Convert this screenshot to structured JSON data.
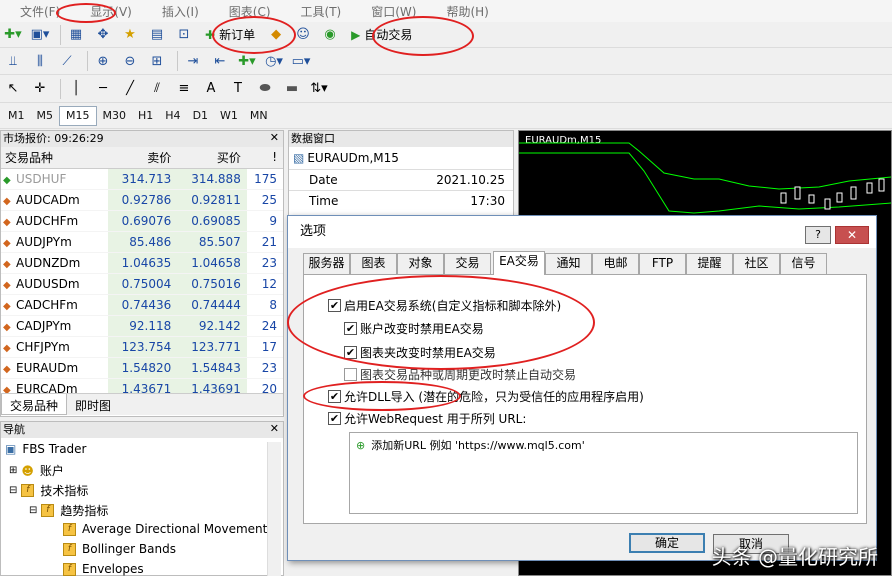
{
  "menu": [
    "文件(F)",
    "显示(V)",
    "插入(I)",
    "图表(C)",
    "工具(T)",
    "窗口(W)",
    "帮助(H)"
  ],
  "toolbar": {
    "new_order": "新订单",
    "auto_trading": "自动交易"
  },
  "draw_tools": [
    "A",
    "T"
  ],
  "timeframes": [
    "M1",
    "M5",
    "M15",
    "M30",
    "H1",
    "H4",
    "D1",
    "W1",
    "MN"
  ],
  "active_timeframe": "M15",
  "market_watch": {
    "title": "市场报价: 09:26:29",
    "headers": [
      "交易品种",
      "卖价",
      "买价",
      "!"
    ],
    "rows": [
      {
        "symbol": "USDHUF",
        "bid": "314.713",
        "ask": "314.888",
        "spread": "175",
        "dim": true
      },
      {
        "symbol": "AUDCADm",
        "bid": "0.92786",
        "ask": "0.92811",
        "spread": "25"
      },
      {
        "symbol": "AUDCHFm",
        "bid": "0.69076",
        "ask": "0.69085",
        "spread": "9"
      },
      {
        "symbol": "AUDJPYm",
        "bid": "85.486",
        "ask": "85.507",
        "spread": "21"
      },
      {
        "symbol": "AUDNZDm",
        "bid": "1.04635",
        "ask": "1.04658",
        "spread": "23"
      },
      {
        "symbol": "AUDUSDm",
        "bid": "0.75004",
        "ask": "0.75016",
        "spread": "12"
      },
      {
        "symbol": "CADCHFm",
        "bid": "0.74436",
        "ask": "0.74444",
        "spread": "8"
      },
      {
        "symbol": "CADJPYm",
        "bid": "92.118",
        "ask": "92.142",
        "spread": "24"
      },
      {
        "symbol": "CHFJPYm",
        "bid": "123.754",
        "ask": "123.771",
        "spread": "17"
      },
      {
        "symbol": "EURAUDm",
        "bid": "1.54820",
        "ask": "1.54843",
        "spread": "23"
      },
      {
        "symbol": "EURCADm",
        "bid": "1.43671",
        "ask": "1.43691",
        "spread": "20"
      }
    ],
    "tabs": [
      "交易品种",
      "即时图"
    ]
  },
  "navigator": {
    "title": "导航",
    "items": [
      "FBS Trader",
      "账户",
      "技术指标",
      "趋势指标",
      "Average Directional Movement",
      "Bollinger Bands",
      "Envelopes"
    ]
  },
  "data_window": {
    "title": "数据窗口",
    "symbol": "EURAUDm,M15",
    "rows": [
      {
        "label": "Date",
        "value": "2021.10.25"
      },
      {
        "label": "Time",
        "value": "17:30"
      }
    ]
  },
  "chart": {
    "label": "EURAUDm,M15"
  },
  "dialog": {
    "title": "选项",
    "tabs": [
      "服务器",
      "图表",
      "对象",
      "交易",
      "EA交易",
      "通知",
      "电邮",
      "FTP",
      "提醒",
      "社区",
      "信号"
    ],
    "active_tab": "EA交易",
    "options": [
      {
        "label": "启用EA交易系统(自定义指标和脚本除外)",
        "checked": true
      },
      {
        "label": "账户改变时禁用EA交易",
        "checked": true
      },
      {
        "label": "图表夹改变时禁用EA交易",
        "checked": true
      },
      {
        "label": "图表交易品种或周期更改时禁止自动交易",
        "checked": false
      },
      {
        "label": "允许DLL导入 (潜在的危险，只为受信任的应用程序启用)",
        "checked": true
      },
      {
        "label": "允许WebRequest 用于所列 URL:",
        "checked": true
      }
    ],
    "add_url_hint": "添加新URL 例如 'https://www.mql5.com'",
    "ok_label": "确定",
    "cancel_label": "取消"
  },
  "watermark": "头条 @量化研究所",
  "colors": {
    "annotation": "#e02020",
    "chart_bg": "#000000",
    "chart_line": "#00ff00",
    "price_text": "#1846a6"
  }
}
